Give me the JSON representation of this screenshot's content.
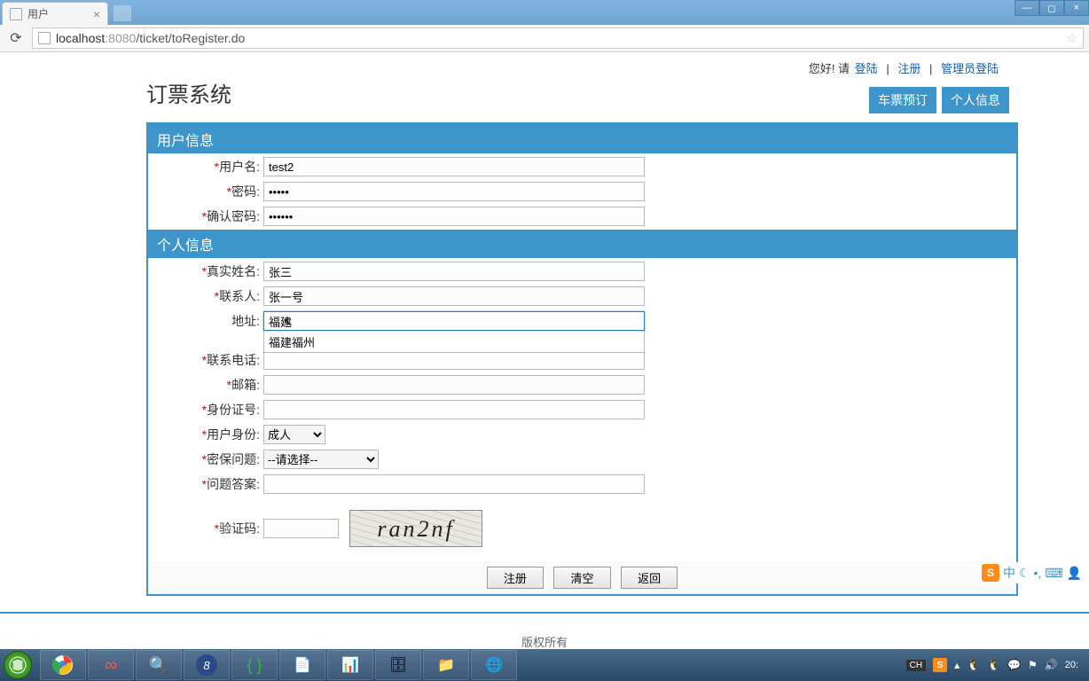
{
  "browser": {
    "tab_title": "用户",
    "url_host": "localhost",
    "url_port": ":8080",
    "url_path": "/ticket/toRegister.do"
  },
  "header": {
    "site_title": "订票系统",
    "greeting_prefix": "您好! 请 ",
    "login": "登陆",
    "register": "注册",
    "admin_login": "管理员登陆",
    "nav_booking": "车票预订",
    "nav_profile": "个人信息"
  },
  "sections": {
    "user_info": "用户信息",
    "personal_info": "个人信息"
  },
  "labels": {
    "username": "用户名:",
    "password": "密码:",
    "confirm_password": "确认密码:",
    "realname": "真实姓名:",
    "contact": "联系人:",
    "address": "地址:",
    "phone": "联系电话:",
    "email": "邮箱:",
    "idcard": "身份证号:",
    "user_type": "用户身份:",
    "security_q": "密保问题:",
    "security_a": "问题答案:",
    "captcha": "验证码:"
  },
  "values": {
    "username": "test2",
    "password": "•••••",
    "confirm_password": "••••••",
    "realname": "张三",
    "contact": "张一号",
    "address": "福建",
    "address_suggestion": "福建福州",
    "phone": "",
    "email": "",
    "idcard": "",
    "user_type": "成人",
    "security_q": "--请选择--",
    "security_a": "",
    "captcha": "",
    "captcha_text": "ran2nf"
  },
  "buttons": {
    "register": "注册",
    "clear": "清空",
    "back": "返回"
  },
  "footer": {
    "copyright": "版权所有"
  },
  "ime": {
    "logo": "S",
    "mode": "中"
  },
  "tray": {
    "lang": "CH",
    "time": "20:"
  }
}
